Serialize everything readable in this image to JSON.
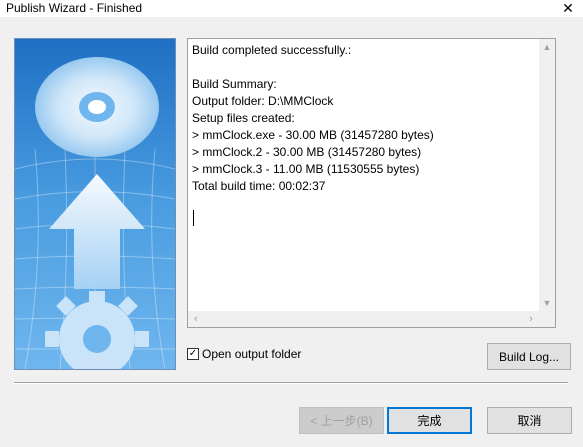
{
  "window": {
    "title": "Publish Wizard - Finished",
    "close_glyph": "✕"
  },
  "log": {
    "lines": [
      "Build completed successfully.:",
      "",
      "Build Summary:",
      "Output folder: D:\\MMClock",
      "Setup files created:",
      "> mmClock.exe - 30.00 MB (31457280 bytes)",
      "> mmClock.2 - 30.00 MB (31457280 bytes)",
      "> mmClock.3 - 11.00 MB (11530555 bytes)",
      "Total build time: 00:02:37"
    ]
  },
  "options": {
    "open_output_label": "Open output folder",
    "open_output_checked": true
  },
  "buttons": {
    "build_log": "Build Log...",
    "back": "< 上一步(B)",
    "finish": "完成",
    "cancel": "取消"
  },
  "colors": {
    "accent": "#0078d7",
    "image_blue": "#3d8fd6"
  }
}
